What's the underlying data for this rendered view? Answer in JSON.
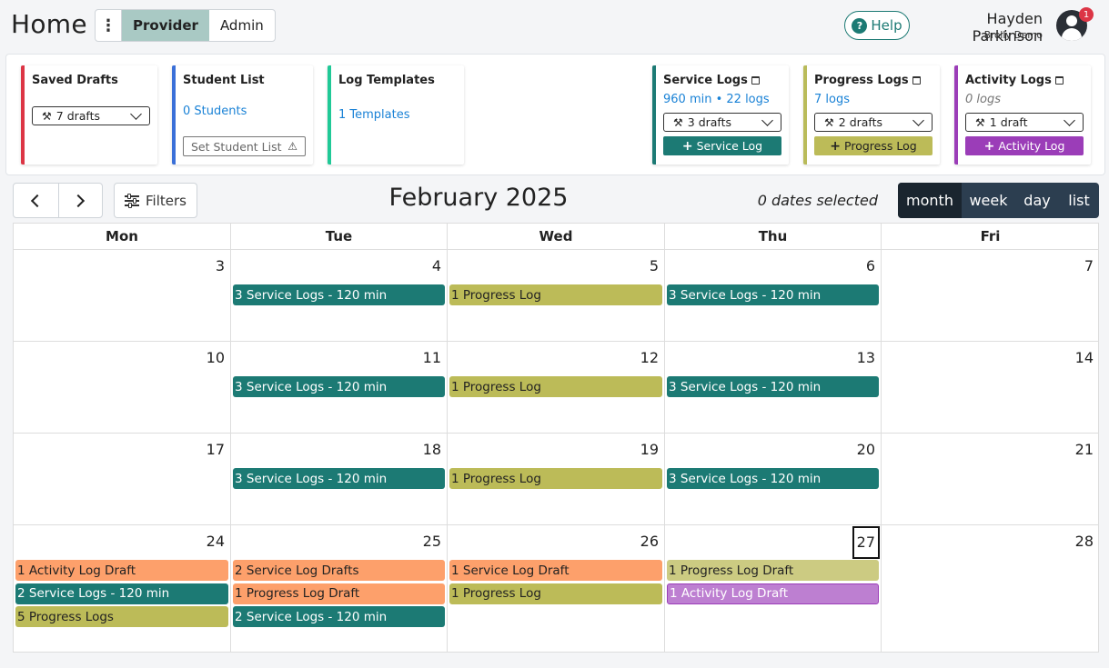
{
  "header": {
    "title": "Home",
    "roles": [
      "Provider",
      "Admin"
    ],
    "active_role": "Provider",
    "help_label": "Help",
    "help_glyph": "?",
    "user_name": "Hayden Parkinson",
    "user_org": "Brolly Demo",
    "notification_count": "1"
  },
  "cards": {
    "saved_drafts": {
      "title": "Saved Drafts",
      "dropdown": "7 drafts",
      "color": "#dc3545"
    },
    "student_list": {
      "title": "Student List",
      "link": "0 Students",
      "set_label": "Set Student List",
      "color": "#3a6fd8"
    },
    "log_templates": {
      "title": "Log Templates",
      "link": "1 Templates",
      "color": "#20c997"
    },
    "service_logs": {
      "title": "Service Logs",
      "summary": "960 min • 22 logs",
      "dropdown": "3 drafts",
      "button": "Service Log",
      "color": "#1c7a74"
    },
    "progress_logs": {
      "title": "Progress Logs",
      "summary": "7 logs",
      "dropdown": "2 drafts",
      "button": "Progress Log",
      "color": "#b9bb5a"
    },
    "activity_logs": {
      "title": "Activity Logs",
      "summary": "0 logs",
      "dropdown": "1 draft",
      "button": "Activity Log",
      "color": "#9b3db8"
    }
  },
  "toolbar": {
    "filters_label": "Filters",
    "calendar_title": "February 2025",
    "dates_selected": "0 dates selected",
    "views": [
      "month",
      "week",
      "day",
      "list"
    ],
    "active_view": "month"
  },
  "calendar": {
    "day_headers": [
      "Mon",
      "Tue",
      "Wed",
      "Thu",
      "Fri"
    ],
    "today": "27",
    "weeks": [
      [
        {
          "date": "3",
          "events": []
        },
        {
          "date": "4",
          "events": [
            {
              "label": "3 Service Logs - 120 min",
              "kind": "service"
            }
          ]
        },
        {
          "date": "5",
          "events": [
            {
              "label": "1 Progress Log",
              "kind": "progress"
            }
          ]
        },
        {
          "date": "6",
          "events": [
            {
              "label": "3 Service Logs - 120 min",
              "kind": "service"
            }
          ]
        },
        {
          "date": "7",
          "events": []
        }
      ],
      [
        {
          "date": "10",
          "events": []
        },
        {
          "date": "11",
          "events": [
            {
              "label": "3 Service Logs - 120 min",
              "kind": "service"
            }
          ]
        },
        {
          "date": "12",
          "events": [
            {
              "label": "1 Progress Log",
              "kind": "progress"
            }
          ]
        },
        {
          "date": "13",
          "events": [
            {
              "label": "3 Service Logs - 120 min",
              "kind": "service"
            }
          ]
        },
        {
          "date": "14",
          "events": []
        }
      ],
      [
        {
          "date": "17",
          "events": []
        },
        {
          "date": "18",
          "events": [
            {
              "label": "3 Service Logs - 120 min",
              "kind": "service"
            }
          ]
        },
        {
          "date": "19",
          "events": [
            {
              "label": "1 Progress Log",
              "kind": "progress"
            }
          ]
        },
        {
          "date": "20",
          "events": [
            {
              "label": "3 Service Logs - 120 min",
              "kind": "service"
            }
          ]
        },
        {
          "date": "21",
          "events": []
        }
      ],
      [
        {
          "date": "24",
          "events": [
            {
              "label": "1 Activity Log Draft",
              "kind": "draft"
            },
            {
              "label": "2 Service Logs - 120 min",
              "kind": "service"
            },
            {
              "label": "5 Progress Logs",
              "kind": "progress"
            }
          ]
        },
        {
          "date": "25",
          "events": [
            {
              "label": "2 Service Log Drafts",
              "kind": "draft"
            },
            {
              "label": "1 Progress Log Draft",
              "kind": "draft"
            },
            {
              "label": "2 Service Logs - 120 min",
              "kind": "service"
            }
          ]
        },
        {
          "date": "26",
          "events": [
            {
              "label": "1 Service Log Draft",
              "kind": "draft"
            },
            {
              "label": "1 Progress Log",
              "kind": "progress"
            }
          ]
        },
        {
          "date": "27",
          "events": [
            {
              "label": "1 Progress Log Draft",
              "kind": "progress-draft"
            },
            {
              "label": "1 Activity Log Draft",
              "kind": "activity-draft"
            }
          ]
        },
        {
          "date": "28",
          "events": []
        }
      ]
    ]
  },
  "colors": {
    "service": "#1c7a74",
    "progress": "#bcbb58",
    "draft": "#fda06b",
    "progress-draft": "#cccb82",
    "activity-draft": "#bd7fd1"
  }
}
